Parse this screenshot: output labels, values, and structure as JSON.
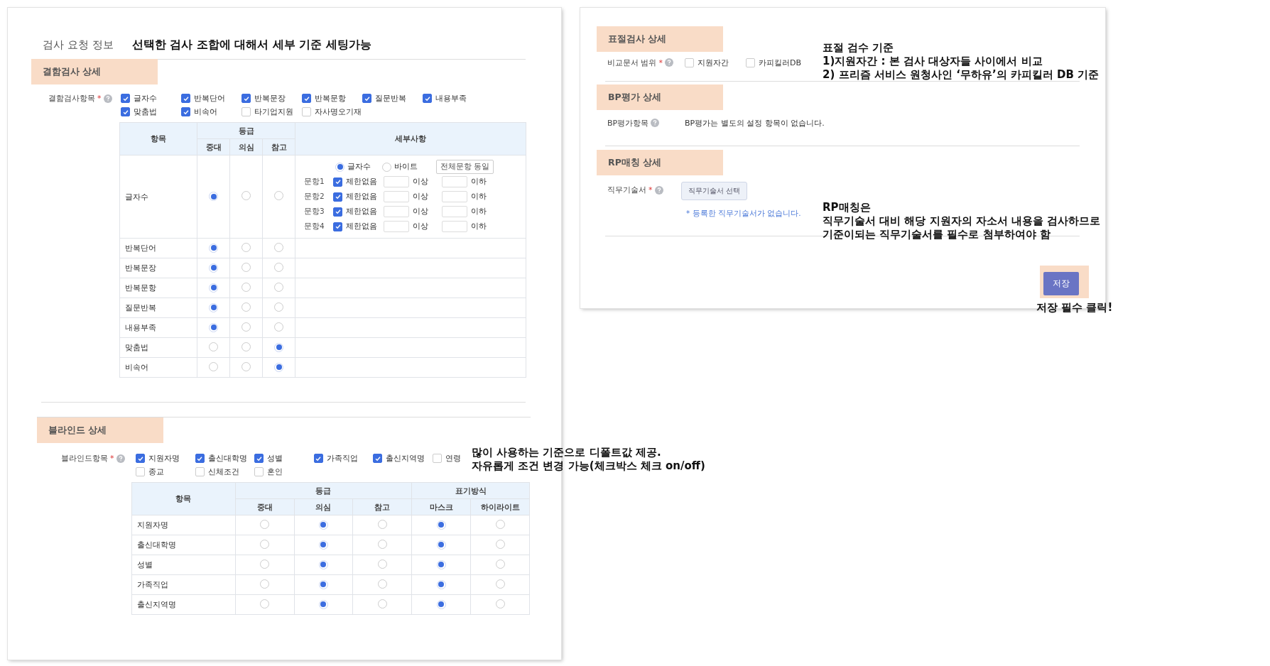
{
  "request_info": {
    "label": "검사 요청 정보",
    "note": "선택한 검사 조합에 대해서 세부 기준 세팅가능"
  },
  "defect": {
    "title": "결함검사 상세",
    "field_label": "결함검사항목",
    "required_mark": "*",
    "options": [
      {
        "label": "글자수",
        "checked": true
      },
      {
        "label": "반복단어",
        "checked": true
      },
      {
        "label": "반복문장",
        "checked": true
      },
      {
        "label": "반복문항",
        "checked": true
      },
      {
        "label": "질문반복",
        "checked": true
      },
      {
        "label": "내용부족",
        "checked": true
      },
      {
        "label": "맞춤법",
        "checked": true
      },
      {
        "label": "비속어",
        "checked": true
      },
      {
        "label": "타기업지원",
        "checked": false
      },
      {
        "label": "자사명오기재",
        "checked": false
      }
    ],
    "table": {
      "item_header": "항목",
      "grade_header": "등급",
      "grades": [
        "중대",
        "의심",
        "참고"
      ],
      "detail_header": "세부사항",
      "detail": {
        "units": [
          {
            "label": "글자수",
            "selected": true
          },
          {
            "label": "바이트",
            "selected": false
          }
        ],
        "same_button": "전체문항 동일",
        "questions": [
          {
            "label": "문항1",
            "no_limit": "제한없음",
            "checked": true,
            "min_suffix": "이상",
            "max_suffix": "이하"
          },
          {
            "label": "문항2",
            "no_limit": "제한없음",
            "checked": true,
            "min_suffix": "이상",
            "max_suffix": "이하"
          },
          {
            "label": "문항3",
            "no_limit": "제한없음",
            "checked": true,
            "min_suffix": "이상",
            "max_suffix": "이하"
          },
          {
            "label": "문항4",
            "no_limit": "제한없음",
            "checked": true,
            "min_suffix": "이상",
            "max_suffix": "이하"
          }
        ]
      },
      "rows": [
        {
          "label": "글자수",
          "kind": "detail",
          "grades": [
            {
              "selected": true
            },
            {
              "selected": false
            },
            {
              "selected": false
            }
          ]
        },
        {
          "label": "반복단어",
          "kind": "plain",
          "grades": [
            {
              "selected": true
            },
            {
              "selected": false
            },
            {
              "selected": false
            }
          ]
        },
        {
          "label": "반복문장",
          "kind": "plain",
          "grades": [
            {
              "selected": true
            },
            {
              "selected": false
            },
            {
              "selected": false
            }
          ]
        },
        {
          "label": "반복문항",
          "kind": "plain",
          "grades": [
            {
              "selected": true
            },
            {
              "selected": false
            },
            {
              "selected": false
            }
          ]
        },
        {
          "label": "질문반복",
          "kind": "plain",
          "grades": [
            {
              "selected": true
            },
            {
              "selected": false
            },
            {
              "selected": false
            }
          ]
        },
        {
          "label": "내용부족",
          "kind": "plain",
          "grades": [
            {
              "selected": true
            },
            {
              "selected": false
            },
            {
              "selected": false
            }
          ]
        },
        {
          "label": "맞춤법",
          "kind": "plain",
          "grades": [
            {
              "selected": false
            },
            {
              "selected": false
            },
            {
              "selected": true
            }
          ]
        },
        {
          "label": "비속어",
          "kind": "plain",
          "grades": [
            {
              "selected": false
            },
            {
              "selected": false
            },
            {
              "selected": true
            }
          ]
        }
      ]
    }
  },
  "blind": {
    "title": "블라인드 상세",
    "field_label": "블라인드항목",
    "required_mark": "*",
    "options": [
      {
        "label": "지원자명",
        "checked": true
      },
      {
        "label": "출신대학명",
        "checked": true
      },
      {
        "label": "성별",
        "checked": true
      },
      {
        "label": "가족직업",
        "checked": true
      },
      {
        "label": "출신지역명",
        "checked": true
      },
      {
        "label": "연령",
        "checked": false
      },
      {
        "label": "종교",
        "checked": false
      },
      {
        "label": "신체조건",
        "checked": false
      },
      {
        "label": "혼인",
        "checked": false
      }
    ],
    "table": {
      "item_header": "항목",
      "grade_header": "등급",
      "grades": [
        "중대",
        "의심",
        "참고"
      ],
      "display_header": "표기방식",
      "displays": [
        "마스크",
        "하이라이트"
      ],
      "rows": [
        {
          "label": "지원자명",
          "grades": [
            {
              "selected": false
            },
            {
              "selected": true
            },
            {
              "selected": false
            }
          ],
          "displays": [
            {
              "selected": true
            },
            {
              "selected": false
            }
          ]
        },
        {
          "label": "출신대학명",
          "grades": [
            {
              "selected": false
            },
            {
              "selected": true
            },
            {
              "selected": false
            }
          ],
          "displays": [
            {
              "selected": true
            },
            {
              "selected": false
            }
          ]
        },
        {
          "label": "성별",
          "grades": [
            {
              "selected": false
            },
            {
              "selected": true
            },
            {
              "selected": false
            }
          ],
          "displays": [
            {
              "selected": true
            },
            {
              "selected": false
            }
          ]
        },
        {
          "label": "가족직업",
          "grades": [
            {
              "selected": false
            },
            {
              "selected": true
            },
            {
              "selected": false
            }
          ],
          "displays": [
            {
              "selected": true
            },
            {
              "selected": false
            }
          ]
        },
        {
          "label": "출신지역명",
          "grades": [
            {
              "selected": false
            },
            {
              "selected": true
            },
            {
              "selected": false
            }
          ],
          "displays": [
            {
              "selected": true
            },
            {
              "selected": false
            }
          ]
        }
      ]
    }
  },
  "plagiarism": {
    "title": "표절검사 상세",
    "field_label": "비교문서 범위",
    "required_mark": "*",
    "options": [
      {
        "label": "지원자간",
        "checked": false
      },
      {
        "label": "카피킬러DB",
        "checked": false
      }
    ]
  },
  "bp": {
    "title": "BP평가 상세",
    "field_label": "BP평가항목",
    "text": "BP평가는 별도의 설정 항목이 없습니다."
  },
  "rp": {
    "title": "RP매칭 상세",
    "field_label": "직무기술서",
    "required_mark": "*",
    "button": "직무기술서 선택",
    "notice": "* 등록한 직무기술서가 없습니다."
  },
  "save_button": "저장",
  "annotations": {
    "plagiarism_note": [
      "표절 검수 기준",
      "1)지원자간 : 본 검사 대상자들 사이에서 비교",
      "2) 프리즘 서비스 원청사인 ‘무하유’의 카피킬러 DB 기준"
    ],
    "rp_note": [
      "RP매칭은",
      "직무기술서 대비 해당 지원자의 자소서 내용을 검사하므로",
      "기준이되는 직무기술서를 필수로 첨부하여야 함"
    ],
    "blind_note": [
      "많이 사용하는 기준으로 디폴트값 제공.",
      "자유롭게 조건 변경 가능(체크박스 체크 on/off)"
    ],
    "save_note": "저장 필수 클릭!"
  }
}
